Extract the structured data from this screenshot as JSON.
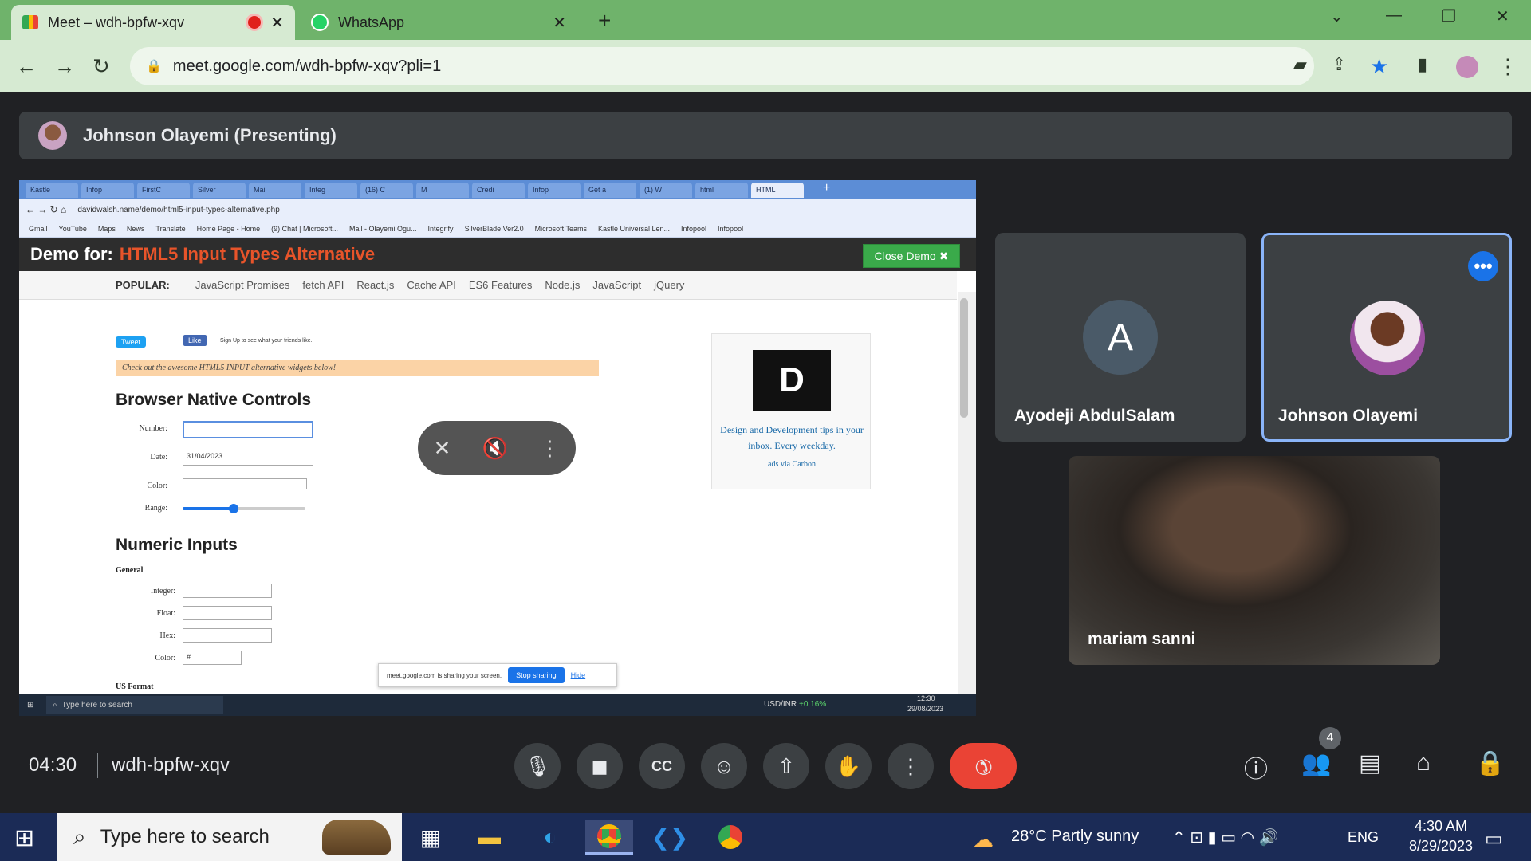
{
  "browser": {
    "tabs": [
      {
        "title": "Meet – wdh-bpfw-xqv",
        "active": true,
        "recording": true
      },
      {
        "title": "WhatsApp",
        "active": false
      }
    ],
    "url": "meet.google.com/wdh-bpfw-xqv?pli=1"
  },
  "meet": {
    "presenter_label": "Johnson Olayemi (Presenting)",
    "time": "04:30",
    "meeting_code": "wdh-bpfw-xqv",
    "people_count": "4",
    "participants": [
      {
        "name": "Ayodeji AbdulSalam",
        "initial": "A"
      },
      {
        "name": "Johnson Olayemi"
      },
      {
        "name": "mariam sanni"
      }
    ]
  },
  "shared": {
    "tabs": [
      "Kastle",
      "Infop",
      "FirstC",
      "Silver",
      "Mail",
      "Integ",
      "(16) C",
      "M",
      "Credi",
      "Infop",
      "Get a",
      "(1) W",
      "html",
      "HTML"
    ],
    "url": "davidwalsh.name/demo/html5-input-types-alternative.php",
    "bookmarks": [
      "Gmail",
      "YouTube",
      "Maps",
      "News",
      "Translate",
      "Home Page - Home",
      "(9) Chat | Microsoft...",
      "Mail - Olayemi Ogu...",
      "Integrify",
      "SilverBlade Ver2.0",
      "Microsoft Teams",
      "Kastle Universal Len...",
      "Infopool",
      "Infopool"
    ],
    "banner_prefix": "Demo for:",
    "banner_title": "HTML5 Input Types Alternative",
    "close_demo": "Close Demo ✖",
    "nav_label": "POPULAR:",
    "nav": [
      "JavaScript Promises",
      "fetch API",
      "React.js",
      "Cache API",
      "ES6 Features",
      "Node.js",
      "JavaScript",
      "jQuery"
    ],
    "tweet": "Tweet",
    "like": "Like",
    "like_text": "Sign Up to see what your friends like.",
    "note": "Check out the awesome HTML5 INPUT alternative widgets below!",
    "h_native": "Browser Native Controls",
    "labels_native": {
      "number": "Number:",
      "date": "Date:",
      "color": "Color:",
      "range": "Range:"
    },
    "date_value": "31/04/2023",
    "h_numeric": "Numeric Inputs",
    "general": "General",
    "labels_numeric": {
      "integer": "Integer:",
      "float": "Float:",
      "hex": "Hex:",
      "color": "Color:"
    },
    "color_value": "#",
    "us_format": "US Format",
    "ad_text": "Design and Development tips in your inbox. Every weekday.",
    "ad_via": "ads via Carbon",
    "sharing_text": "meet.google.com is sharing your screen.",
    "stop_sharing": "Stop sharing",
    "hide": "Hide",
    "taskbar_search": "Type here to search",
    "ticker": "USD/INR",
    "ticker_change": "+0.16%",
    "clock_time": "12:30",
    "clock_date": "29/08/2023"
  },
  "taskbar": {
    "search_placeholder": "Type here to search",
    "weather": "28°C  Partly sunny",
    "lang": "ENG",
    "time": "4:30 AM",
    "date": "8/29/2023"
  },
  "colors": {
    "accent": "#1a73e8",
    "end_call": "#ea4335",
    "tab_strip": "#6fb36b"
  }
}
